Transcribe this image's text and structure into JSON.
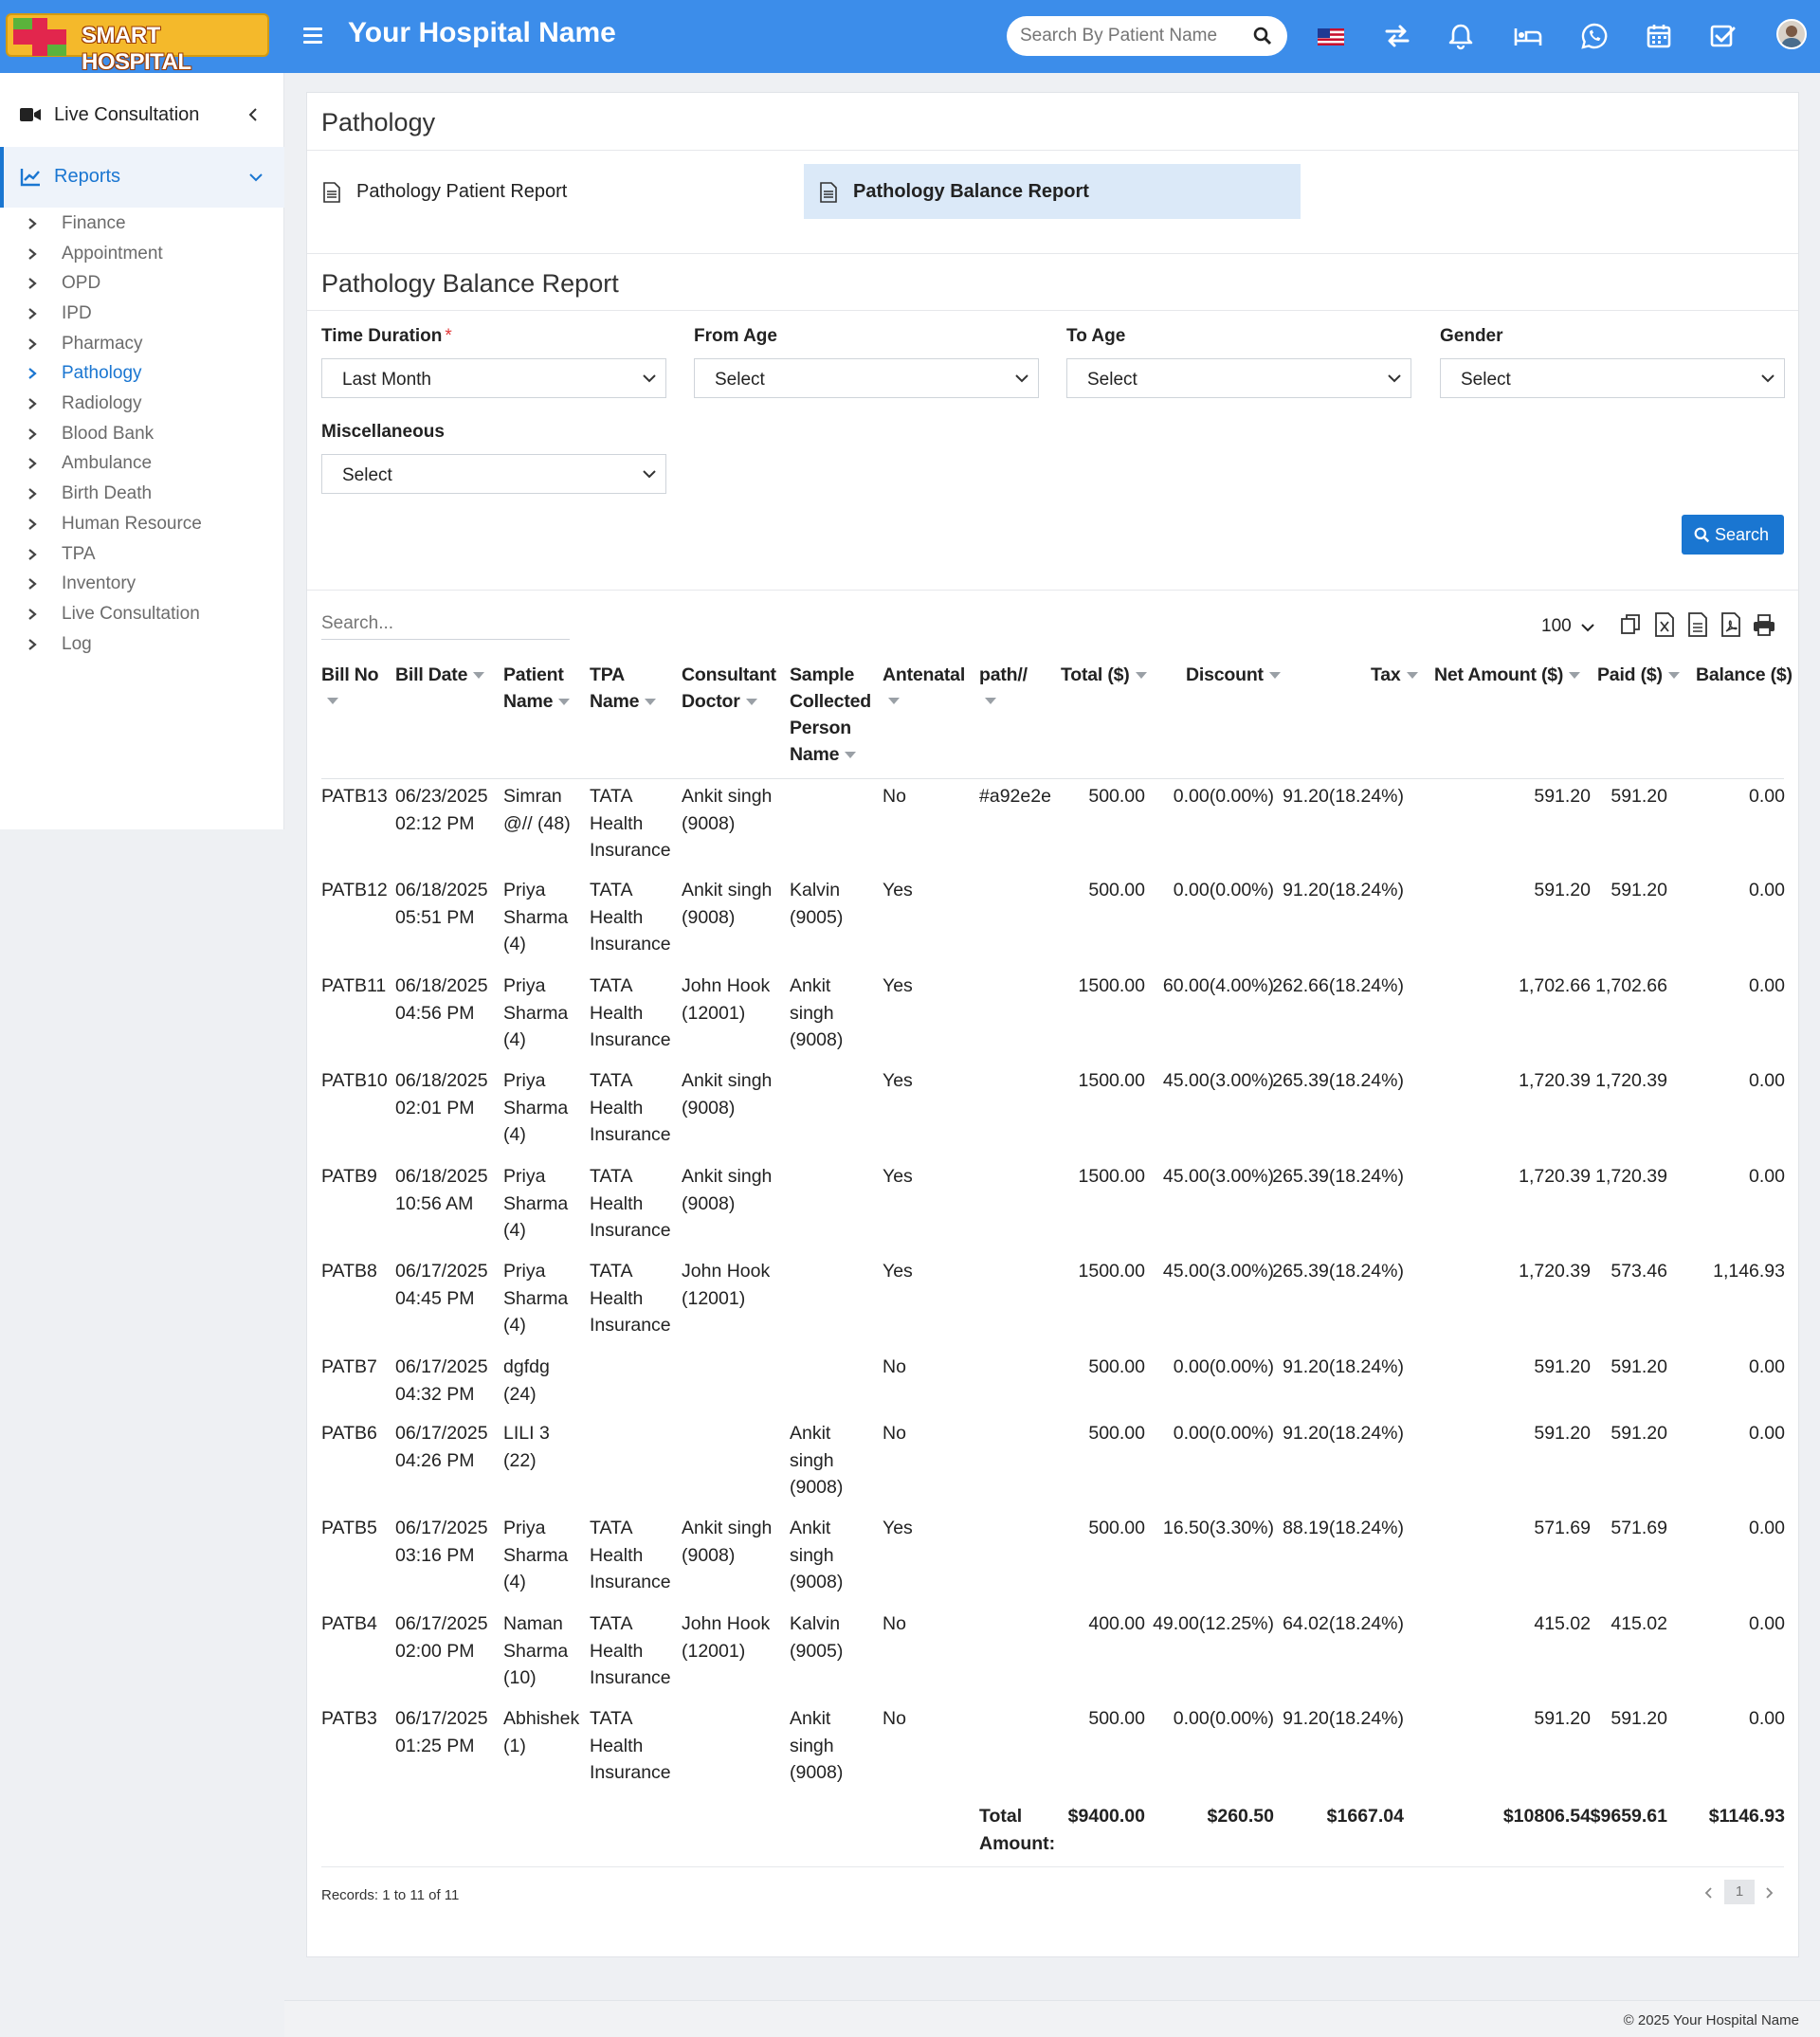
{
  "app": {
    "logo_text": "SMART HOSPITAL",
    "title": "Your Hospital Name"
  },
  "topbar": {
    "search_placeholder": "Search By Patient Name",
    "icons": [
      "flag-us-icon",
      "swap-icon",
      "bell-icon",
      "bed-icon",
      "whatsapp-icon",
      "calendar-icon",
      "checklist-icon",
      "avatar"
    ]
  },
  "sidebar": {
    "live": "Live Consultation",
    "reports": "Reports",
    "items": [
      "Finance",
      "Appointment",
      "OPD",
      "IPD",
      "Pharmacy",
      "Pathology",
      "Radiology",
      "Blood Bank",
      "Ambulance",
      "Birth Death",
      "Human Resource",
      "TPA",
      "Inventory",
      "Live Consultation",
      "Log"
    ],
    "active_item": "Pathology"
  },
  "page": {
    "title": "Pathology",
    "report_links": [
      "Pathology Patient Report",
      "Pathology Balance Report"
    ],
    "active_report": "Pathology Balance Report",
    "section_title": "Pathology Balance Report"
  },
  "filters": {
    "time_duration": {
      "label": "Time Duration",
      "value": "Last Month",
      "required": true
    },
    "from_age": {
      "label": "From Age",
      "value": "Select"
    },
    "to_age": {
      "label": "To Age",
      "value": "Select"
    },
    "gender": {
      "label": "Gender",
      "value": "Select"
    },
    "misc": {
      "label": "Miscellaneous",
      "value": "Select"
    },
    "search_button": "Search"
  },
  "table": {
    "search_placeholder": "Search...",
    "page_size": "100",
    "columns": [
      "Bill No",
      "Bill Date",
      "Patient Name",
      "TPA Name",
      "Consultant Doctor",
      "Sample Collected Person Name",
      "Antenatal",
      "path//",
      "Total ($)",
      "Discount",
      "Tax",
      "Net Amount ($)",
      "Paid ($)",
      "Balance ($)"
    ],
    "rows": [
      {
        "bill": "PATB13",
        "date": "06/23/2025",
        "time": "02:12 PM",
        "patient": [
          "Simran",
          "@// (48)"
        ],
        "tpa": [
          "TATA",
          "Health",
          "Insurance"
        ],
        "doctor": [
          "Ankit singh",
          "(9008)"
        ],
        "sample": [],
        "antenatal": "No",
        "path": "#a92e2e",
        "total": "500.00",
        "discount": "0.00(0.00%)",
        "tax": "91.20(18.24%)",
        "net": "591.20",
        "paid": "591.20",
        "balance": "0.00"
      },
      {
        "bill": "PATB12",
        "date": "06/18/2025",
        "time": "05:51 PM",
        "patient": [
          "Priya",
          "Sharma",
          "(4)"
        ],
        "tpa": [
          "TATA",
          "Health",
          "Insurance"
        ],
        "doctor": [
          "Ankit singh",
          "(9008)"
        ],
        "sample": [
          "Kalvin",
          "(9005)"
        ],
        "antenatal": "Yes",
        "path": "",
        "total": "500.00",
        "discount": "0.00(0.00%)",
        "tax": "91.20(18.24%)",
        "net": "591.20",
        "paid": "591.20",
        "balance": "0.00"
      },
      {
        "bill": "PATB11",
        "date": "06/18/2025",
        "time": "04:56 PM",
        "patient": [
          "Priya",
          "Sharma",
          "(4)"
        ],
        "tpa": [
          "TATA",
          "Health",
          "Insurance"
        ],
        "doctor": [
          "John Hook",
          "(12001)"
        ],
        "sample": [
          "Ankit",
          "singh",
          "(9008)"
        ],
        "antenatal": "Yes",
        "path": "",
        "total": "1500.00",
        "discount": "60.00(4.00%)",
        "tax": "262.66(18.24%)",
        "net": "1,702.66",
        "paid": "1,702.66",
        "balance": "0.00"
      },
      {
        "bill": "PATB10",
        "date": "06/18/2025",
        "time": "02:01 PM",
        "patient": [
          "Priya",
          "Sharma",
          "(4)"
        ],
        "tpa": [
          "TATA",
          "Health",
          "Insurance"
        ],
        "doctor": [
          "Ankit singh",
          "(9008)"
        ],
        "sample": [],
        "antenatal": "Yes",
        "path": "",
        "total": "1500.00",
        "discount": "45.00(3.00%)",
        "tax": "265.39(18.24%)",
        "net": "1,720.39",
        "paid": "1,720.39",
        "balance": "0.00"
      },
      {
        "bill": "PATB9",
        "date": "06/18/2025",
        "time": "10:56 AM",
        "patient": [
          "Priya",
          "Sharma",
          "(4)"
        ],
        "tpa": [
          "TATA",
          "Health",
          "Insurance"
        ],
        "doctor": [
          "Ankit singh",
          "(9008)"
        ],
        "sample": [],
        "antenatal": "Yes",
        "path": "",
        "total": "1500.00",
        "discount": "45.00(3.00%)",
        "tax": "265.39(18.24%)",
        "net": "1,720.39",
        "paid": "1,720.39",
        "balance": "0.00"
      },
      {
        "bill": "PATB8",
        "date": "06/17/2025",
        "time": "04:45 PM",
        "patient": [
          "Priya",
          "Sharma",
          "(4)"
        ],
        "tpa": [
          "TATA",
          "Health",
          "Insurance"
        ],
        "doctor": [
          "John Hook",
          "(12001)"
        ],
        "sample": [],
        "antenatal": "Yes",
        "path": "",
        "total": "1500.00",
        "discount": "45.00(3.00%)",
        "tax": "265.39(18.24%)",
        "net": "1,720.39",
        "paid": "573.46",
        "balance": "1,146.93"
      },
      {
        "bill": "PATB7",
        "date": "06/17/2025",
        "time": "04:32 PM",
        "patient": [
          "dgfdg",
          "(24)"
        ],
        "tpa": [],
        "doctor": [],
        "sample": [],
        "antenatal": "No",
        "path": "",
        "total": "500.00",
        "discount": "0.00(0.00%)",
        "tax": "91.20(18.24%)",
        "net": "591.20",
        "paid": "591.20",
        "balance": "0.00"
      },
      {
        "bill": "PATB6",
        "date": "06/17/2025",
        "time": "04:26 PM",
        "patient": [
          "LILI 3",
          "(22)"
        ],
        "tpa": [],
        "doctor": [],
        "sample": [
          "Ankit",
          "singh",
          "(9008)"
        ],
        "antenatal": "No",
        "path": "",
        "total": "500.00",
        "discount": "0.00(0.00%)",
        "tax": "91.20(18.24%)",
        "net": "591.20",
        "paid": "591.20",
        "balance": "0.00"
      },
      {
        "bill": "PATB5",
        "date": "06/17/2025",
        "time": "03:16 PM",
        "patient": [
          "Priya",
          "Sharma",
          "(4)"
        ],
        "tpa": [
          "TATA",
          "Health",
          "Insurance"
        ],
        "doctor": [
          "Ankit singh",
          "(9008)"
        ],
        "sample": [
          "Ankit",
          "singh",
          "(9008)"
        ],
        "antenatal": "Yes",
        "path": "",
        "total": "500.00",
        "discount": "16.50(3.30%)",
        "tax": "88.19(18.24%)",
        "net": "571.69",
        "paid": "571.69",
        "balance": "0.00"
      },
      {
        "bill": "PATB4",
        "date": "06/17/2025",
        "time": "02:00 PM",
        "patient": [
          "Naman",
          "Sharma",
          "(10)"
        ],
        "tpa": [
          "TATA",
          "Health",
          "Insurance"
        ],
        "doctor": [
          "John Hook",
          "(12001)"
        ],
        "sample": [
          "Kalvin",
          "(9005)"
        ],
        "antenatal": "No",
        "path": "",
        "total": "400.00",
        "discount": "49.00(12.25%)",
        "tax": "64.02(18.24%)",
        "net": "415.02",
        "paid": "415.02",
        "balance": "0.00"
      },
      {
        "bill": "PATB3",
        "date": "06/17/2025",
        "time": "01:25 PM",
        "patient": [
          "Abhishek",
          "(1)"
        ],
        "tpa": [
          "TATA",
          "Health",
          "Insurance"
        ],
        "doctor": [],
        "sample": [
          "Ankit",
          "singh",
          "(9008)"
        ],
        "antenatal": "No",
        "path": "",
        "total": "500.00",
        "discount": "0.00(0.00%)",
        "tax": "91.20(18.24%)",
        "net": "591.20",
        "paid": "591.20",
        "balance": "0.00"
      }
    ],
    "totals": {
      "label": "Total Amount:",
      "total": "$9400.00",
      "discount": "$260.50",
      "tax": "$1667.04",
      "net": "$10806.54",
      "paid": "$9659.61",
      "balance": "$1146.93"
    },
    "records_info": "Records: 1 to 11 of 11",
    "current_page": "1"
  },
  "footer": {
    "copyright": "© 2025 Your Hospital Name"
  },
  "colors": {
    "topbar": "#3c8dea",
    "primary": "#1a76d1",
    "active_tab_bg": "#dbe9f8"
  }
}
